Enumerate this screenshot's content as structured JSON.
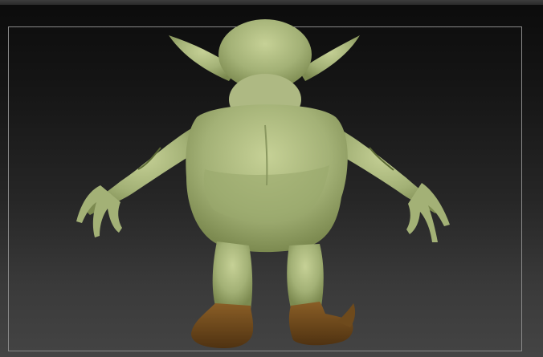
{
  "colors": {
    "skin": "#a7b57a",
    "skin_dark": "#6f7d45",
    "skin_light": "#cbd59d",
    "boots": "#6e4a1c",
    "boots_dark": "#4a3010",
    "frame": "#8a8a8a"
  },
  "viewport": {
    "subject": "goblin-model"
  }
}
